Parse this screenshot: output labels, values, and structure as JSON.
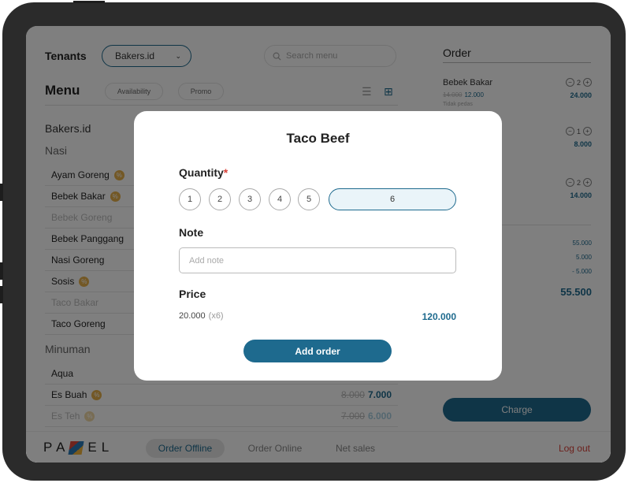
{
  "header": {
    "tenants_label": "Tenants",
    "tenant_selected": "Bakers.id",
    "search_placeholder": "Search menu",
    "menu_title": "Menu",
    "availability_label": "Availability",
    "promo_label": "Promo"
  },
  "menu": {
    "store_name": "Bakers.id",
    "categories": [
      {
        "name": "Nasi",
        "items": [
          {
            "name": "Ayam Goreng",
            "badge": true,
            "disabled": false
          },
          {
            "name": "Bebek Bakar",
            "badge": true,
            "disabled": false
          },
          {
            "name": "Bebek Goreng",
            "badge": false,
            "disabled": true
          },
          {
            "name": "Bebek Panggang",
            "badge": false,
            "disabled": false
          },
          {
            "name": "Nasi Goreng",
            "badge": false,
            "disabled": false
          },
          {
            "name": "Sosis",
            "badge": true,
            "disabled": false
          },
          {
            "name": "Taco Bakar",
            "badge": false,
            "disabled": true
          },
          {
            "name": "Taco Goreng",
            "badge": false,
            "disabled": false
          }
        ]
      },
      {
        "name": "Minuman",
        "items": [
          {
            "name": "Aqua",
            "badge": false,
            "disabled": false,
            "price": "",
            "old_price": ""
          },
          {
            "name": "Es Buah",
            "badge": true,
            "disabled": false,
            "price": "7.000",
            "old_price": "8.000"
          },
          {
            "name": "Es Teh",
            "badge": true,
            "disabled": true,
            "price": "6.000",
            "old_price": "7.000"
          }
        ]
      }
    ]
  },
  "order": {
    "title": "Order",
    "items": [
      {
        "name": "Bebek Bakar",
        "old_price": "14.000",
        "price": "12.000",
        "note": "Tidak pedas",
        "qty": "2",
        "total": "24.000"
      },
      {
        "qty": "1",
        "total": "8.000"
      },
      {
        "qty": "2",
        "total": "14.000"
      }
    ],
    "summary": {
      "subtotal": "55.000",
      "tax": "5.000",
      "discount": "- 5.000"
    },
    "grand_total": "55.500",
    "charge_label": "Charge"
  },
  "bottom_nav": {
    "logo_left": "PA",
    "logo_right": "EL",
    "items": [
      "Order Offline",
      "Order Online",
      "Net sales"
    ],
    "logout": "Log out"
  },
  "modal": {
    "title": "Taco Beef",
    "quantity_label": "Quantity",
    "quantity_required": "*",
    "quantity_options": [
      "1",
      "2",
      "3",
      "4",
      "5"
    ],
    "quantity_selected": "6",
    "note_label": "Note",
    "note_placeholder": "Add note",
    "price_label": "Price",
    "unit_price": "20.000",
    "multiplier": "(x6)",
    "total_price": "120.000",
    "add_order_label": "Add order"
  },
  "colors": {
    "accent": "#1e6a8e",
    "logout": "#d9423a",
    "badge": "#e6b04a"
  }
}
